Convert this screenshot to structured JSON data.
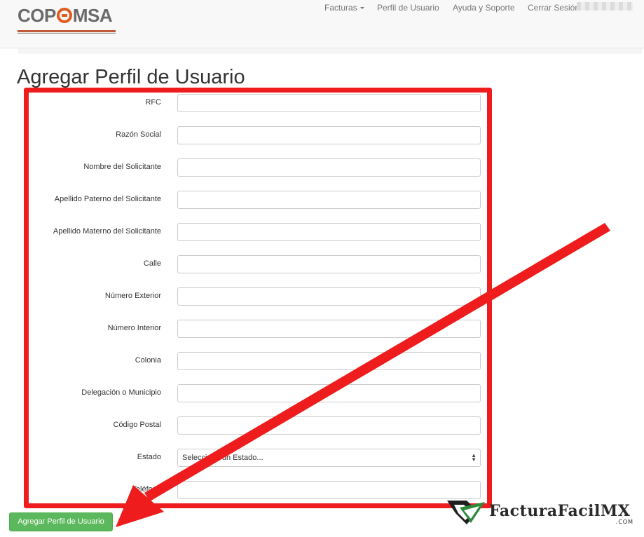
{
  "navbar": {
    "logo_text_left": "COP",
    "logo_text_right": "MSA",
    "items": [
      {
        "label": "Facturas"
      },
      {
        "label": "Perfil de Usuario"
      },
      {
        "label": "Ayuda y Soporte"
      },
      {
        "label": "Cerrar Sesión"
      }
    ]
  },
  "page": {
    "title": "Agregar Perfil de Usuario"
  },
  "form": {
    "fields": [
      {
        "label": "RFC",
        "value": ""
      },
      {
        "label": "Razón Social",
        "value": ""
      },
      {
        "label": "Nombre del Solicitante",
        "value": ""
      },
      {
        "label": "Apellido Paterno del Solicitante",
        "value": ""
      },
      {
        "label": "Apellido Materno del Solicitante",
        "value": ""
      },
      {
        "label": "Calle",
        "value": ""
      },
      {
        "label": "Número Exterior",
        "value": ""
      },
      {
        "label": "Número Interior",
        "value": ""
      },
      {
        "label": "Colonia",
        "value": ""
      },
      {
        "label": "Delegación o Municipio",
        "value": ""
      },
      {
        "label": "Código Postal",
        "value": ""
      }
    ],
    "estado": {
      "label": "Estado",
      "selected": "Seleccione un Estado..."
    },
    "telefono": {
      "label": "Teléfono",
      "value": ""
    },
    "submit_label": "Agregar Perfil de Usuario"
  },
  "watermark": {
    "text": "FacturaFacil",
    "suffix": "MX",
    "domain": ".COM"
  },
  "colors": {
    "highlight": "#ee1c1c",
    "submit": "#5cb85c",
    "logo_accent": "#e05a1c"
  }
}
